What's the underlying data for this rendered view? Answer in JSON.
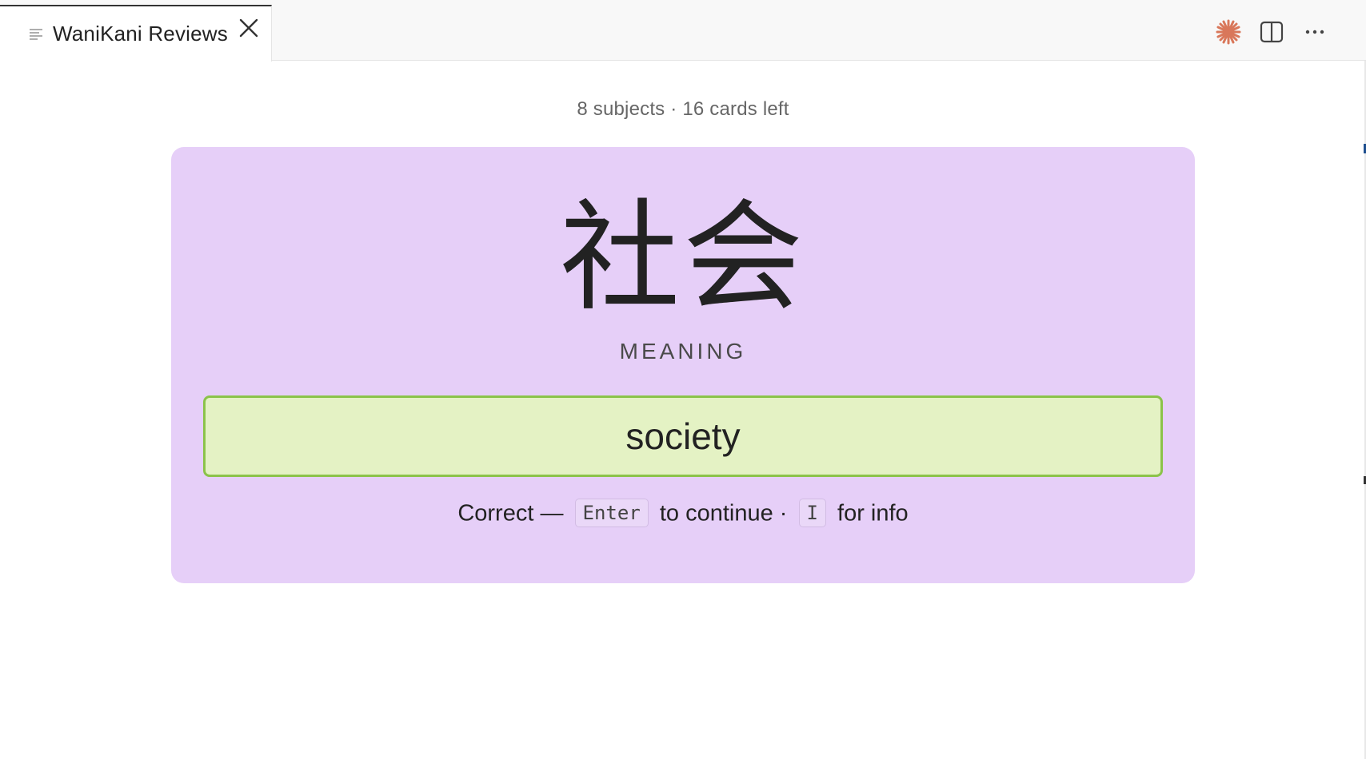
{
  "tab": {
    "title": "WaniKani Reviews",
    "preview_icon": "markdown-preview-icon",
    "close_icon": "close-icon"
  },
  "actions": [
    {
      "name": "claude-sparkle-icon",
      "color": "#d9775a"
    },
    {
      "name": "split-editor-icon"
    },
    {
      "name": "more-actions-icon"
    }
  ],
  "progress": {
    "text": "8 subjects · 16 cards left"
  },
  "card": {
    "background": "#e6cff8",
    "subject": "社会",
    "question_type": "MEANING",
    "answer": {
      "value": "society",
      "state": "correct",
      "background": "#e4f2c4",
      "border": "#8bc34a"
    },
    "hint": {
      "result": "Correct —",
      "key_continue": "Enter",
      "continue_text": "to continue ·",
      "key_info": "I",
      "info_text": "for info"
    }
  }
}
